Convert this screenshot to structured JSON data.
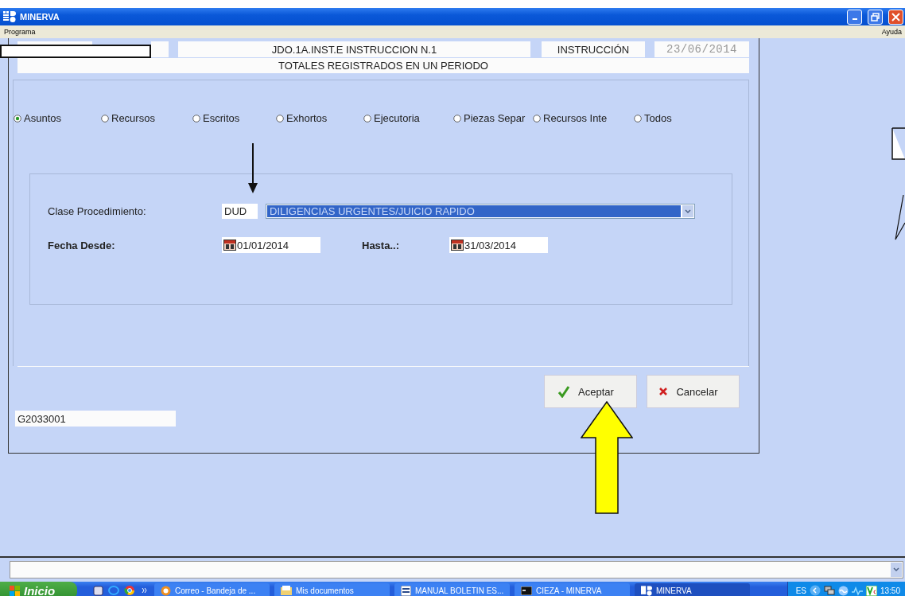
{
  "window": {
    "title": "MINERVA"
  },
  "menu": {
    "left": "Programa",
    "right": "Ayuda"
  },
  "header": {
    "court": "JDO.1A.INST.E INSTRUCCION N.1",
    "type": "INSTRUCCIÓN",
    "date": "23/06/2014",
    "subtitle": "TOTALES REGISTRADOS EN UN PERIODO"
  },
  "options": [
    {
      "label": "Asuntos",
      "selected": true
    },
    {
      "label": "Recursos",
      "selected": false
    },
    {
      "label": "Escritos",
      "selected": false
    },
    {
      "label": "Exhortos",
      "selected": false
    },
    {
      "label": "Ejecutoria",
      "selected": false
    },
    {
      "label": "Piezas Separ",
      "selected": false
    },
    {
      "label": "Recursos Inte",
      "selected": false
    },
    {
      "label": "Todos",
      "selected": false
    }
  ],
  "procedure": {
    "label": "Clase Procedimiento:",
    "code": "DUD",
    "value": "DILIGENCIAS URGENTES/JUICIO RAPIDO"
  },
  "date_from": {
    "label": "Fecha Desde:",
    "value": "01/01/2014"
  },
  "date_to": {
    "label": "Hasta..:",
    "value": "31/03/2014"
  },
  "buttons": [
    {
      "label": "Aceptar",
      "kind": "accept"
    },
    {
      "label": "Cancelar",
      "kind": "cancel"
    }
  ],
  "user_code": "G2033001",
  "taskbar": {
    "start": "Inicio",
    "tasks": [
      {
        "label": "Correo - Bandeja de ...",
        "kind": "mail",
        "selected": false
      },
      {
        "label": "Mis documentos",
        "kind": "folder",
        "selected": false
      },
      {
        "label": "MANUAL BOLETIN ES...",
        "kind": "doc",
        "selected": false
      },
      {
        "label": "CIEZA - MINERVA",
        "kind": "console",
        "selected": false
      },
      {
        "label": "MINERVA",
        "kind": "app",
        "selected": true
      }
    ],
    "language": "ES",
    "clock": "13:50"
  }
}
